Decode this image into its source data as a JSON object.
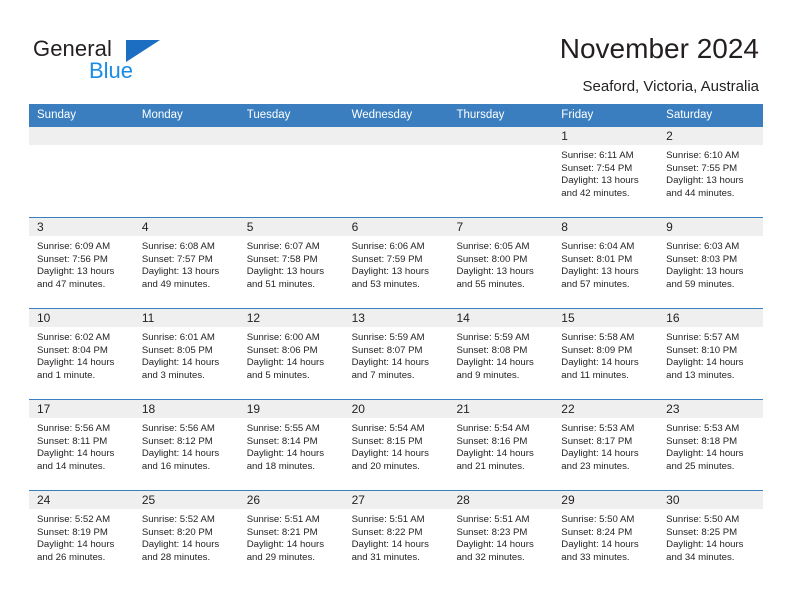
{
  "brand": {
    "name_part1": "General",
    "name_part2": "Blue",
    "triangle_color": "#1b6ec2",
    "blue_color": "#1b8ce3"
  },
  "header": {
    "title": "November 2024",
    "subtitle": "Seaford, Victoria, Australia"
  },
  "colors": {
    "header_band": "#3a7ebf",
    "daynum_strip": "#efefef",
    "text": "#231f20",
    "cell_background": "#ffffff"
  },
  "calendar": {
    "weekday_headers": [
      "Sunday",
      "Monday",
      "Tuesday",
      "Wednesday",
      "Thursday",
      "Friday",
      "Saturday"
    ],
    "weeks": [
      [
        {
          "day": "",
          "sunrise": "",
          "sunset": "",
          "daylight_line1": "",
          "daylight_line2": ""
        },
        {
          "day": "",
          "sunrise": "",
          "sunset": "",
          "daylight_line1": "",
          "daylight_line2": ""
        },
        {
          "day": "",
          "sunrise": "",
          "sunset": "",
          "daylight_line1": "",
          "daylight_line2": ""
        },
        {
          "day": "",
          "sunrise": "",
          "sunset": "",
          "daylight_line1": "",
          "daylight_line2": ""
        },
        {
          "day": "",
          "sunrise": "",
          "sunset": "",
          "daylight_line1": "",
          "daylight_line2": ""
        },
        {
          "day": "1",
          "sunrise": "Sunrise: 6:11 AM",
          "sunset": "Sunset: 7:54 PM",
          "daylight_line1": "Daylight: 13 hours",
          "daylight_line2": "and 42 minutes."
        },
        {
          "day": "2",
          "sunrise": "Sunrise: 6:10 AM",
          "sunset": "Sunset: 7:55 PM",
          "daylight_line1": "Daylight: 13 hours",
          "daylight_line2": "and 44 minutes."
        }
      ],
      [
        {
          "day": "3",
          "sunrise": "Sunrise: 6:09 AM",
          "sunset": "Sunset: 7:56 PM",
          "daylight_line1": "Daylight: 13 hours",
          "daylight_line2": "and 47 minutes."
        },
        {
          "day": "4",
          "sunrise": "Sunrise: 6:08 AM",
          "sunset": "Sunset: 7:57 PM",
          "daylight_line1": "Daylight: 13 hours",
          "daylight_line2": "and 49 minutes."
        },
        {
          "day": "5",
          "sunrise": "Sunrise: 6:07 AM",
          "sunset": "Sunset: 7:58 PM",
          "daylight_line1": "Daylight: 13 hours",
          "daylight_line2": "and 51 minutes."
        },
        {
          "day": "6",
          "sunrise": "Sunrise: 6:06 AM",
          "sunset": "Sunset: 7:59 PM",
          "daylight_line1": "Daylight: 13 hours",
          "daylight_line2": "and 53 minutes."
        },
        {
          "day": "7",
          "sunrise": "Sunrise: 6:05 AM",
          "sunset": "Sunset: 8:00 PM",
          "daylight_line1": "Daylight: 13 hours",
          "daylight_line2": "and 55 minutes."
        },
        {
          "day": "8",
          "sunrise": "Sunrise: 6:04 AM",
          "sunset": "Sunset: 8:01 PM",
          "daylight_line1": "Daylight: 13 hours",
          "daylight_line2": "and 57 minutes."
        },
        {
          "day": "9",
          "sunrise": "Sunrise: 6:03 AM",
          "sunset": "Sunset: 8:03 PM",
          "daylight_line1": "Daylight: 13 hours",
          "daylight_line2": "and 59 minutes."
        }
      ],
      [
        {
          "day": "10",
          "sunrise": "Sunrise: 6:02 AM",
          "sunset": "Sunset: 8:04 PM",
          "daylight_line1": "Daylight: 14 hours",
          "daylight_line2": "and 1 minute."
        },
        {
          "day": "11",
          "sunrise": "Sunrise: 6:01 AM",
          "sunset": "Sunset: 8:05 PM",
          "daylight_line1": "Daylight: 14 hours",
          "daylight_line2": "and 3 minutes."
        },
        {
          "day": "12",
          "sunrise": "Sunrise: 6:00 AM",
          "sunset": "Sunset: 8:06 PM",
          "daylight_line1": "Daylight: 14 hours",
          "daylight_line2": "and 5 minutes."
        },
        {
          "day": "13",
          "sunrise": "Sunrise: 5:59 AM",
          "sunset": "Sunset: 8:07 PM",
          "daylight_line1": "Daylight: 14 hours",
          "daylight_line2": "and 7 minutes."
        },
        {
          "day": "14",
          "sunrise": "Sunrise: 5:59 AM",
          "sunset": "Sunset: 8:08 PM",
          "daylight_line1": "Daylight: 14 hours",
          "daylight_line2": "and 9 minutes."
        },
        {
          "day": "15",
          "sunrise": "Sunrise: 5:58 AM",
          "sunset": "Sunset: 8:09 PM",
          "daylight_line1": "Daylight: 14 hours",
          "daylight_line2": "and 11 minutes."
        },
        {
          "day": "16",
          "sunrise": "Sunrise: 5:57 AM",
          "sunset": "Sunset: 8:10 PM",
          "daylight_line1": "Daylight: 14 hours",
          "daylight_line2": "and 13 minutes."
        }
      ],
      [
        {
          "day": "17",
          "sunrise": "Sunrise: 5:56 AM",
          "sunset": "Sunset: 8:11 PM",
          "daylight_line1": "Daylight: 14 hours",
          "daylight_line2": "and 14 minutes."
        },
        {
          "day": "18",
          "sunrise": "Sunrise: 5:56 AM",
          "sunset": "Sunset: 8:12 PM",
          "daylight_line1": "Daylight: 14 hours",
          "daylight_line2": "and 16 minutes."
        },
        {
          "day": "19",
          "sunrise": "Sunrise: 5:55 AM",
          "sunset": "Sunset: 8:14 PM",
          "daylight_line1": "Daylight: 14 hours",
          "daylight_line2": "and 18 minutes."
        },
        {
          "day": "20",
          "sunrise": "Sunrise: 5:54 AM",
          "sunset": "Sunset: 8:15 PM",
          "daylight_line1": "Daylight: 14 hours",
          "daylight_line2": "and 20 minutes."
        },
        {
          "day": "21",
          "sunrise": "Sunrise: 5:54 AM",
          "sunset": "Sunset: 8:16 PM",
          "daylight_line1": "Daylight: 14 hours",
          "daylight_line2": "and 21 minutes."
        },
        {
          "day": "22",
          "sunrise": "Sunrise: 5:53 AM",
          "sunset": "Sunset: 8:17 PM",
          "daylight_line1": "Daylight: 14 hours",
          "daylight_line2": "and 23 minutes."
        },
        {
          "day": "23",
          "sunrise": "Sunrise: 5:53 AM",
          "sunset": "Sunset: 8:18 PM",
          "daylight_line1": "Daylight: 14 hours",
          "daylight_line2": "and 25 minutes."
        }
      ],
      [
        {
          "day": "24",
          "sunrise": "Sunrise: 5:52 AM",
          "sunset": "Sunset: 8:19 PM",
          "daylight_line1": "Daylight: 14 hours",
          "daylight_line2": "and 26 minutes."
        },
        {
          "day": "25",
          "sunrise": "Sunrise: 5:52 AM",
          "sunset": "Sunset: 8:20 PM",
          "daylight_line1": "Daylight: 14 hours",
          "daylight_line2": "and 28 minutes."
        },
        {
          "day": "26",
          "sunrise": "Sunrise: 5:51 AM",
          "sunset": "Sunset: 8:21 PM",
          "daylight_line1": "Daylight: 14 hours",
          "daylight_line2": "and 29 minutes."
        },
        {
          "day": "27",
          "sunrise": "Sunrise: 5:51 AM",
          "sunset": "Sunset: 8:22 PM",
          "daylight_line1": "Daylight: 14 hours",
          "daylight_line2": "and 31 minutes."
        },
        {
          "day": "28",
          "sunrise": "Sunrise: 5:51 AM",
          "sunset": "Sunset: 8:23 PM",
          "daylight_line1": "Daylight: 14 hours",
          "daylight_line2": "and 32 minutes."
        },
        {
          "day": "29",
          "sunrise": "Sunrise: 5:50 AM",
          "sunset": "Sunset: 8:24 PM",
          "daylight_line1": "Daylight: 14 hours",
          "daylight_line2": "and 33 minutes."
        },
        {
          "day": "30",
          "sunrise": "Sunrise: 5:50 AM",
          "sunset": "Sunset: 8:25 PM",
          "daylight_line1": "Daylight: 14 hours",
          "daylight_line2": "and 34 minutes."
        }
      ]
    ]
  }
}
